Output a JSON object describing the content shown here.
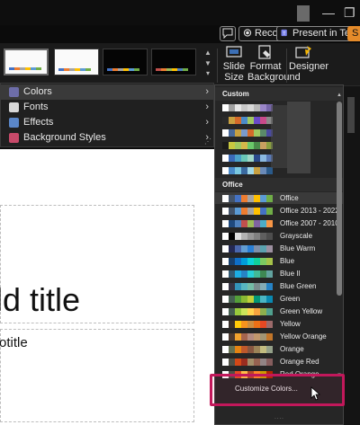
{
  "titlebar": {
    "minimize_glyph": "—",
    "restore_glyph": "❐",
    "close_glyph": "✕"
  },
  "commands": {
    "record_label": "Record",
    "present_teams_label": "Present in Teams",
    "share_label": "S"
  },
  "ribbon": {
    "slide_size_label": "Slide Size",
    "format_background_label": "Format Background",
    "designer_label": "Designer"
  },
  "variants_menu": {
    "items": [
      {
        "label": "Colors",
        "icon": "palette-icon"
      },
      {
        "label": "Fonts",
        "icon": "fonts-icon"
      },
      {
        "label": "Effects",
        "icon": "effects-icon"
      },
      {
        "label": "Background Styles",
        "icon": "background-styles-icon"
      }
    ],
    "chevron": "›"
  },
  "slide": {
    "title_text": "ld title",
    "subtitle_text": "otitle"
  },
  "colors_flyout": {
    "custom_header": "Custom",
    "office_header": "Office",
    "customize_label": "Customize Colors...",
    "custom_palettes": [
      {
        "name": "",
        "colors": [
          "#ffffff",
          "#a0a0a0",
          "#e6e6e6",
          "#c8c8c8",
          "#d8d8d8",
          "#b8b8b8",
          "#9a86c8",
          "#7766aa"
        ]
      },
      {
        "name": "",
        "colors": [
          "#2a2a2a",
          "#c8a040",
          "#d46a2a",
          "#4a8ac8",
          "#a0c860",
          "#6a4ac8",
          "#c84a8a",
          "#8a8a8a"
        ]
      },
      {
        "name": "",
        "colors": [
          "#ffffff",
          "#4a6a9a",
          "#c8a040",
          "#7a9acb",
          "#d46a2a",
          "#a0c860",
          "#5a8a6a",
          "#4a4aa0"
        ]
      },
      {
        "name": "",
        "colors": [
          "#1a1a1a",
          "#c8c840",
          "#a0c860",
          "#d4b84a",
          "#6ac86a",
          "#4a8a4a",
          "#c8a060",
          "#8aa040"
        ]
      },
      {
        "name": "",
        "colors": [
          "#ffffff",
          "#3a6ab8",
          "#4aa0c8",
          "#6ac8b8",
          "#a0d8c8",
          "#2a4a8a",
          "#8ab8e0",
          "#5a7ab8"
        ]
      },
      {
        "name": "",
        "colors": [
          "#ffffff",
          "#4a8ac8",
          "#7ac8e0",
          "#3a6aa0",
          "#a0d8e8",
          "#c8a040",
          "#6a8ab8",
          "#2a5a8a"
        ]
      }
    ],
    "office_palettes": [
      {
        "name": "Office",
        "colors": [
          "#ffffff",
          "#44546a",
          "#4472c4",
          "#ed7d31",
          "#a5a5a5",
          "#ffc000",
          "#5b9bd5",
          "#70ad47"
        ]
      },
      {
        "name": "Office 2013 - 2022",
        "colors": [
          "#ffffff",
          "#44546a",
          "#5b9bd5",
          "#ed7d31",
          "#a5a5a5",
          "#ffc000",
          "#4472c4",
          "#70ad47"
        ]
      },
      {
        "name": "Office 2007 - 2010",
        "colors": [
          "#ffffff",
          "#1f497d",
          "#4f81bd",
          "#c0504d",
          "#9bbb59",
          "#8064a2",
          "#4bacc6",
          "#f79646"
        ]
      },
      {
        "name": "Grayscale",
        "colors": [
          "#ffffff",
          "#000000",
          "#dddddd",
          "#b2b2b2",
          "#969696",
          "#808080",
          "#5f5f5f",
          "#4d4d4d"
        ]
      },
      {
        "name": "Blue Warm",
        "colors": [
          "#ffffff",
          "#242852",
          "#4a66ac",
          "#629dd1",
          "#297fd5",
          "#7f8fa9",
          "#5aa2ae",
          "#9d90a0"
        ]
      },
      {
        "name": "Blue",
        "colors": [
          "#ffffff",
          "#17406d",
          "#0f6fc6",
          "#009dd9",
          "#0bd0d9",
          "#10cf9b",
          "#7cca62",
          "#a5c249"
        ]
      },
      {
        "name": "Blue II",
        "colors": [
          "#ffffff",
          "#335b74",
          "#1cade4",
          "#2683c6",
          "#27ced7",
          "#42ba97",
          "#3e8853",
          "#62a39f"
        ]
      },
      {
        "name": "Blue Green",
        "colors": [
          "#ffffff",
          "#373545",
          "#3494ba",
          "#58b6c0",
          "#75bda7",
          "#7a8c8e",
          "#84acb6",
          "#2683c6"
        ]
      },
      {
        "name": "Green",
        "colors": [
          "#ffffff",
          "#455f51",
          "#549e39",
          "#8ab833",
          "#c0cf3a",
          "#029676",
          "#4ab5c4",
          "#0989b1"
        ]
      },
      {
        "name": "Green Yellow",
        "colors": [
          "#ffffff",
          "#455f51",
          "#99ca3c",
          "#cbe45a",
          "#ffd34e",
          "#f7a43f",
          "#8db04e",
          "#50a08e"
        ]
      },
      {
        "name": "Yellow",
        "colors": [
          "#ffffff",
          "#39302a",
          "#ffca08",
          "#f8931d",
          "#ce8d3e",
          "#ec7016",
          "#e64823",
          "#9c6a6a"
        ]
      },
      {
        "name": "Yellow Orange",
        "colors": [
          "#ffffff",
          "#4e3b30",
          "#f0a22e",
          "#a5644e",
          "#b58b80",
          "#c3986d",
          "#a19574",
          "#c17529"
        ]
      },
      {
        "name": "Orange",
        "colors": [
          "#ffffff",
          "#637052",
          "#e48312",
          "#bd582c",
          "#865640",
          "#9b8357",
          "#c2bc80",
          "#94a088"
        ]
      },
      {
        "name": "Orange Red",
        "colors": [
          "#ffffff",
          "#505046",
          "#d34817",
          "#9b2d1f",
          "#a28e6a",
          "#956251",
          "#918485",
          "#855d5d"
        ]
      },
      {
        "name": "Red Orange",
        "colors": [
          "#ffffff",
          "#505046",
          "#e84c22",
          "#ffbd47",
          "#b64926",
          "#ff8427",
          "#cc9900",
          "#b22600"
        ]
      }
    ]
  }
}
